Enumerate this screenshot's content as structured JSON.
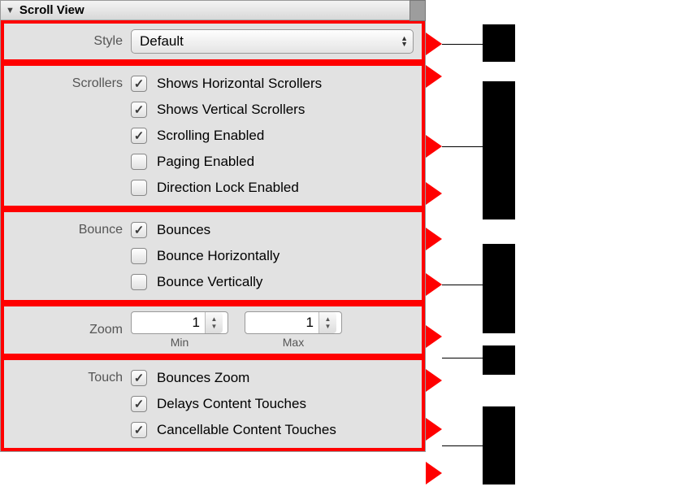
{
  "header": {
    "title": "Scroll View"
  },
  "style": {
    "label": "Style",
    "value": "Default"
  },
  "scrollers": {
    "label": "Scrollers",
    "items": [
      {
        "checked": true,
        "label": "Shows Horizontal Scrollers"
      },
      {
        "checked": true,
        "label": "Shows Vertical Scrollers"
      },
      {
        "checked": true,
        "label": "Scrolling Enabled"
      },
      {
        "checked": false,
        "label": "Paging Enabled"
      },
      {
        "checked": false,
        "label": "Direction Lock Enabled"
      }
    ]
  },
  "bounce": {
    "label": "Bounce",
    "items": [
      {
        "checked": true,
        "label": "Bounces"
      },
      {
        "checked": false,
        "label": "Bounce Horizontally"
      },
      {
        "checked": false,
        "label": "Bounce Vertically"
      }
    ]
  },
  "zoom": {
    "label": "Zoom",
    "min_label": "Min",
    "max_label": "Max",
    "min_value": "1",
    "max_value": "1"
  },
  "touch": {
    "label": "Touch",
    "items": [
      {
        "checked": true,
        "label": "Bounces Zoom"
      },
      {
        "checked": true,
        "label": "Delays Content Touches"
      },
      {
        "checked": true,
        "label": "Cancellable Content Touches"
      }
    ]
  }
}
